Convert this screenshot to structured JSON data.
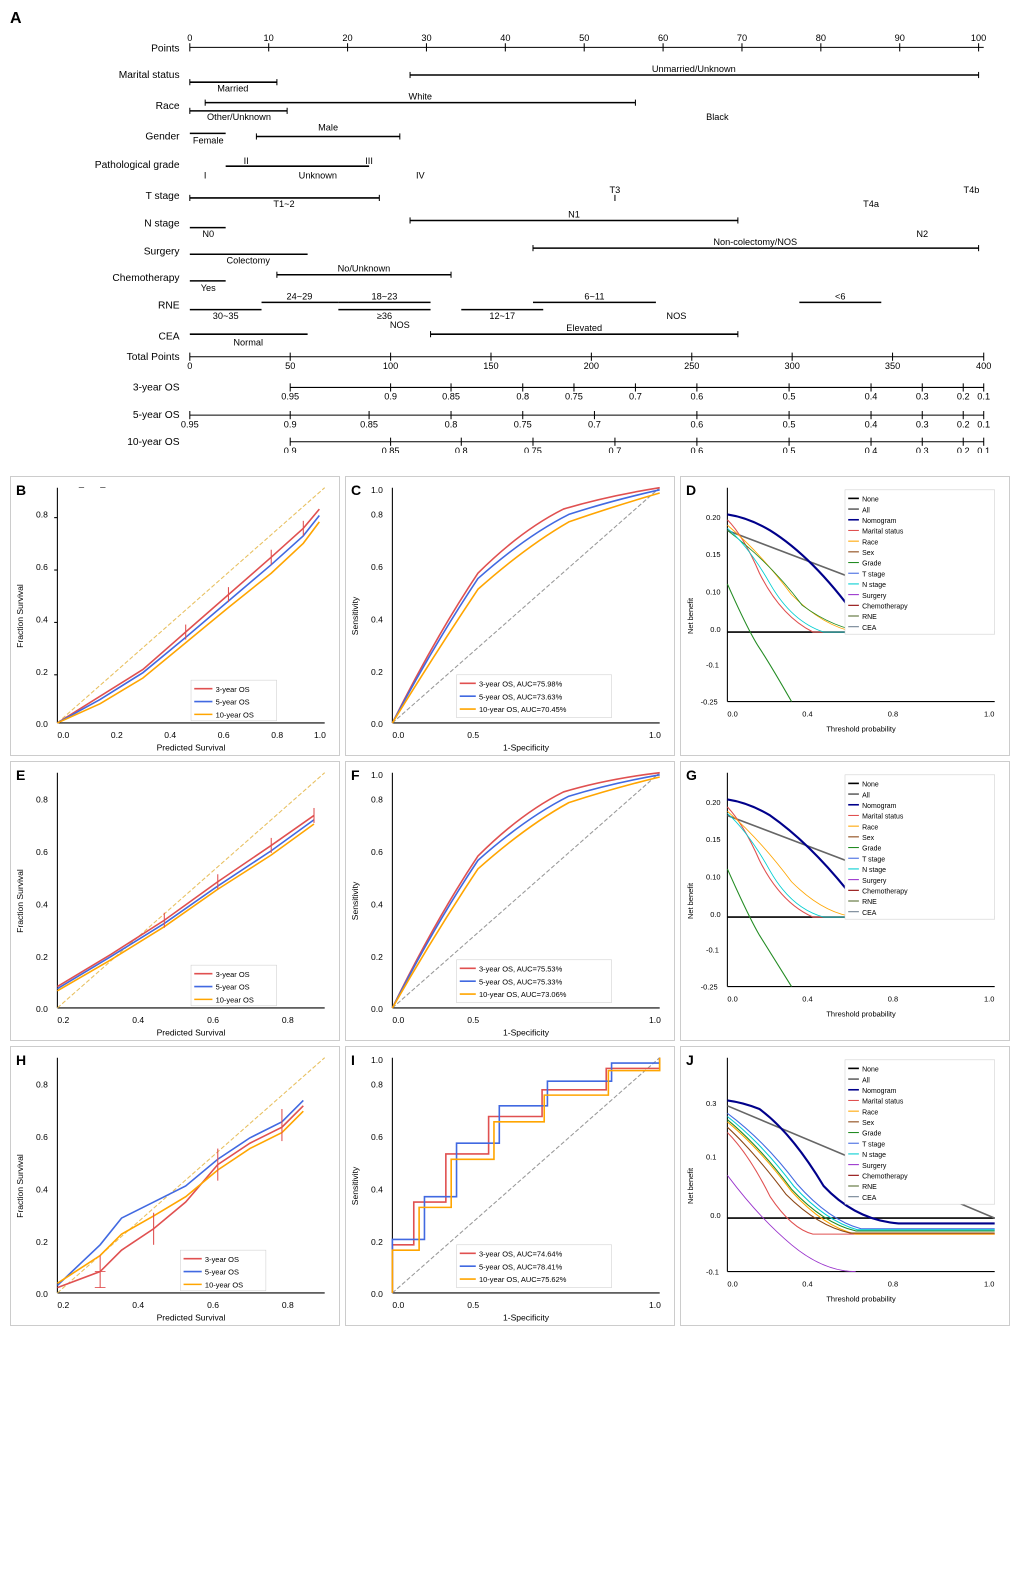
{
  "figure": {
    "section_a_label": "A",
    "section_b_label": "B",
    "section_c_label": "C",
    "section_d_label": "D",
    "section_e_label": "E",
    "section_f_label": "F",
    "section_g_label": "G",
    "section_h_label": "H",
    "section_i_label": "I",
    "section_j_label": "J"
  },
  "nomogram": {
    "rows": [
      {
        "label": "Points",
        "type": "points"
      },
      {
        "label": "Marital status",
        "type": "marital"
      },
      {
        "label": "Race",
        "type": "race"
      },
      {
        "label": "Gender",
        "type": "gender"
      },
      {
        "label": "Pathological grade",
        "type": "grade"
      },
      {
        "label": "T stage",
        "type": "tstage"
      },
      {
        "label": "N stage",
        "type": "nstage"
      },
      {
        "label": "Surgery",
        "type": "surgery"
      },
      {
        "label": "Chemotherapy",
        "type": "chemo"
      },
      {
        "label": "RNE",
        "type": "rne"
      },
      {
        "label": "CEA",
        "type": "cea"
      },
      {
        "label": "Total Points",
        "type": "total"
      },
      {
        "label": "3-year OS",
        "type": "os3"
      },
      {
        "label": "5-year OS",
        "type": "os5"
      },
      {
        "label": "10-year OS",
        "type": "os10"
      }
    ]
  },
  "legend": {
    "calibration": [
      {
        "label": "3-year OS",
        "color": "#e05050"
      },
      {
        "label": "5-year OS",
        "color": "#4169e1"
      },
      {
        "label": "10-year OS",
        "color": "#ffa500"
      }
    ],
    "roc_d": {
      "auc3": "3-year OS, AUC=75.98%",
      "auc5": "5-year OS, AUC=73.63%",
      "auc10": "10-year OS, AUC=70.45%"
    },
    "roc_f": {
      "auc3": "3-year OS, AUC=75.53%",
      "auc5": "5-year OS, AUC=75.33%",
      "auc10": "10-year OS, AUC=73.06%"
    },
    "roc_i": {
      "auc3": "3-year OS, AUC=74.64%",
      "auc5": "5-year OS, AUC=78.41%",
      "auc10": "10-year OS, AUC=75.62%"
    },
    "dca": [
      {
        "label": "None",
        "color": "#000"
      },
      {
        "label": "All",
        "color": "#555"
      },
      {
        "label": "Nomogram",
        "color": "#00008b"
      },
      {
        "label": "Marital status",
        "color": "#e05050"
      },
      {
        "label": "Race",
        "color": "#ffa500"
      },
      {
        "label": "Sex",
        "color": "#8b4513"
      },
      {
        "label": "Grade",
        "color": "#228b22"
      },
      {
        "label": "T stage",
        "color": "#4169e1"
      },
      {
        "label": "N stage",
        "color": "#00ced1"
      },
      {
        "label": "Surgery",
        "color": "#9932cc"
      },
      {
        "label": "Chemotherapy",
        "color": "#8b0000"
      },
      {
        "label": "RNE",
        "color": "#556b2f"
      },
      {
        "label": "CEA",
        "color": "#708090"
      }
    ]
  }
}
